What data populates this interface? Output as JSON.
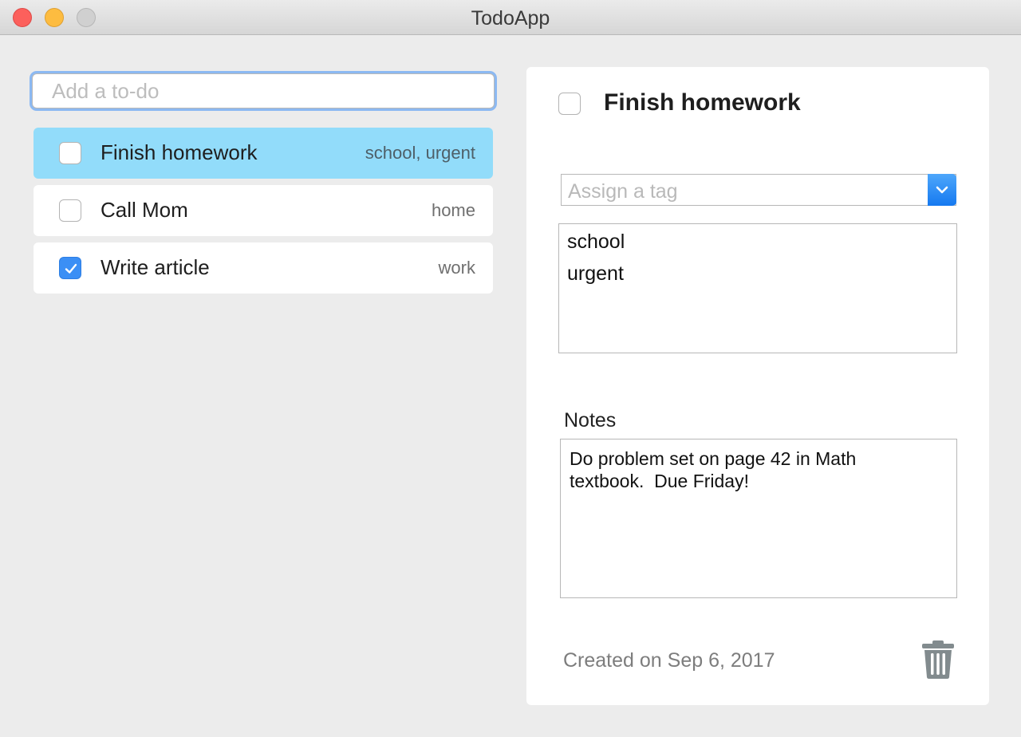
{
  "window": {
    "title": "TodoApp"
  },
  "add_todo": {
    "placeholder": "Add a to-do",
    "value": ""
  },
  "todos": [
    {
      "title": "Finish homework",
      "tags": "school, urgent",
      "done": false,
      "selected": true
    },
    {
      "title": "Call Mom",
      "tags": "home",
      "done": false,
      "selected": false
    },
    {
      "title": "Write article",
      "tags": "work",
      "done": true,
      "selected": false
    }
  ],
  "detail": {
    "title": "Finish homework",
    "done": false,
    "tag_select": {
      "placeholder": "Assign a tag"
    },
    "tags": [
      "school",
      "urgent"
    ],
    "notes_label": "Notes",
    "notes": "Do problem set on page 42 in Math\ntextbook.  Due Friday!",
    "created": "Created on Sep 6, 2017"
  },
  "colors": {
    "selected_row": "#92dcfa",
    "checkbox_checked": "#3b8ff5",
    "focus_ring": "#8cb9f2",
    "select_button": "#1579f0"
  },
  "icons": {
    "close": "close-icon",
    "minimize": "minimize-icon",
    "zoom": "zoom-icon",
    "checkmark": "checkmark-icon",
    "dropdown": "chevron-down-icon",
    "delete": "trash-icon"
  }
}
